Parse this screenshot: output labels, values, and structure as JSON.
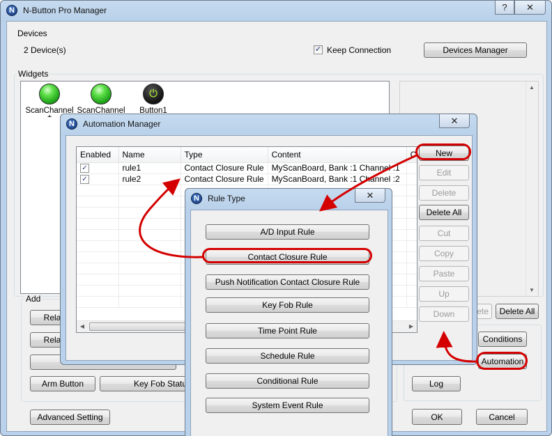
{
  "main": {
    "title": "N-Button Pro Manager",
    "logo_letter": "N",
    "help_button": "?",
    "close_button": "✕",
    "devices": {
      "group_label": "Devices",
      "count_text": "2 Device(s)",
      "keep_connection_label": "Keep Connection",
      "keep_connection_checked": true,
      "devices_manager_button": "Devices Manager"
    },
    "widgets": {
      "group_label": "Widgets",
      "items": [
        {
          "label": "ScanChannel",
          "icon": "green-led-icon"
        },
        {
          "label": "ScanChannel",
          "icon": "green-led-icon"
        },
        {
          "label": "Button1",
          "icon": "power-button-icon"
        }
      ],
      "clip_digit": "1"
    },
    "add": {
      "group_label": "Add",
      "relay_button_1": "Relay",
      "relay_button_2": "Relay",
      "arm_button": "Arm Button",
      "key_fob_status_button": "Key Fob Status"
    },
    "right_buttons": {
      "delete_partial": "ete",
      "delete_all": "Delete All",
      "conditions": "Conditions",
      "automation": "Automation",
      "log": "Log"
    },
    "advanced_setting_button": "Advanced Setting",
    "ok_button": "OK",
    "cancel_button": "Cancel"
  },
  "automation_manager": {
    "title": "Automation Manager",
    "close_button": "✕",
    "columns": [
      "Enabled",
      "Name",
      "Type",
      "Content",
      "Co"
    ],
    "rows": [
      {
        "enabled": true,
        "name": "rule1",
        "type": "Contact Closure Rule",
        "content": "MyScanBoard, Bank :1 Channel :1"
      },
      {
        "enabled": true,
        "name": "rule2",
        "type": "Contact Closure Rule",
        "content": "MyScanBoard, Bank :1 Channel :2"
      }
    ],
    "buttons": [
      {
        "label": "New",
        "enabled": true
      },
      {
        "label": "Edit",
        "enabled": false
      },
      {
        "label": "Delete",
        "enabled": false
      },
      {
        "label": "Delete All",
        "enabled": true
      },
      {
        "label": "Cut",
        "enabled": false
      },
      {
        "label": "Copy",
        "enabled": false
      },
      {
        "label": "Paste",
        "enabled": false
      },
      {
        "label": "Up",
        "enabled": false
      },
      {
        "label": "Down",
        "enabled": false
      }
    ]
  },
  "rule_type": {
    "title": "Rule Type",
    "close_button": "✕",
    "options": [
      "A/D Input Rule",
      "Contact Closure Rule",
      "Push Notification Contact Closure Rule",
      "Key Fob Rule",
      "Time Point Rule",
      "Schedule Rule",
      "Conditional Rule",
      "System Event Rule"
    ]
  },
  "colors": {
    "highlight": "#d40000",
    "title_bar": "#b9d1ea",
    "client_bg": "#f0f0f0"
  }
}
